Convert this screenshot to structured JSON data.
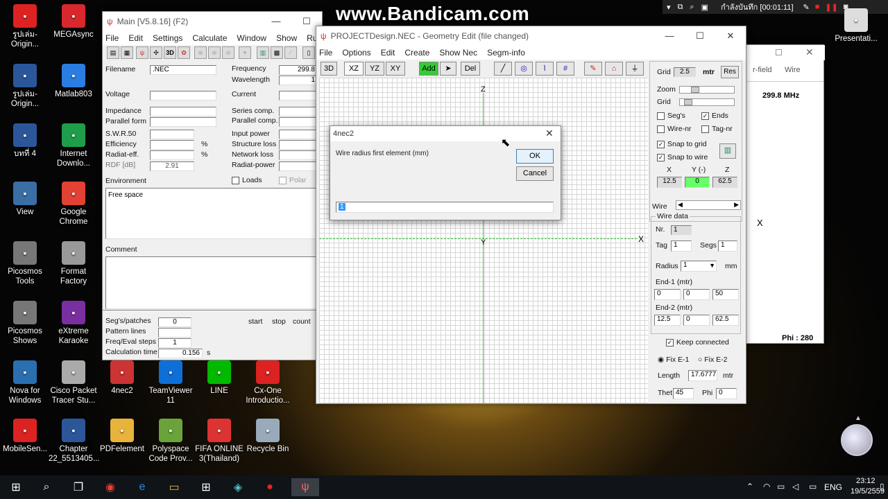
{
  "watermark": "www.Bandicam.com",
  "top_bar": {
    "rec_time": "กำลังบันทึก [00:01:11]"
  },
  "desktop_icons": [
    {
      "label": "รูปเล่ม-Origin...",
      "icon": "pdf-icon",
      "color": "#d22"
    },
    {
      "label": "MEGAsync",
      "icon": "mega-icon",
      "color": "#d9272e"
    },
    {
      "label": "รูปเล่ม-Origin...",
      "icon": "word-icon",
      "color": "#2b579a"
    },
    {
      "label": "Matlab803",
      "icon": "lightning-icon",
      "color": "#2a7de1"
    },
    {
      "label": "บทที่ 4",
      "icon": "word-icon",
      "color": "#2b579a"
    },
    {
      "label": "Internet Downlo...",
      "icon": "globe-icon",
      "color": "#1e9e4a"
    },
    {
      "label": "View",
      "icon": "view-icon",
      "color": "#3a6ea5"
    },
    {
      "label": "Google Chrome",
      "icon": "chrome-icon",
      "color": "#e34133"
    },
    {
      "label": "Picosmos Tools",
      "icon": "picosmos-icon",
      "color": "#777"
    },
    {
      "label": "Format Factory",
      "icon": "format-factory-icon",
      "color": "#999"
    },
    {
      "label": "Picosmos Shows",
      "icon": "picosmos-icon",
      "color": "#777"
    },
    {
      "label": "eXtreme Karaoke",
      "icon": "karaoke-icon",
      "color": "#7a2fa0"
    },
    {
      "label": "Nova for Windows",
      "icon": "nova-icon",
      "color": "#2a6fb0"
    },
    {
      "label": "Cisco Packet Tracer Stu...",
      "icon": "cisco-icon",
      "color": "#aaa"
    },
    {
      "label": "4nec2",
      "icon": "antenna-icon",
      "color": "#c33"
    },
    {
      "label": "TeamViewer 11",
      "icon": "teamviewer-icon",
      "color": "#0e6fd6"
    },
    {
      "label": "LINE",
      "icon": "line-icon",
      "color": "#00b900"
    },
    {
      "label": "Cx-One Introductio...",
      "icon": "pdf-icon",
      "color": "#d22"
    },
    {
      "label": "MobileSen...",
      "icon": "pdf-icon",
      "color": "#d22"
    },
    {
      "label": "Chapter 22_5513405...",
      "icon": "word-icon",
      "color": "#2b579a"
    },
    {
      "label": "PDFelement",
      "icon": "folder-icon",
      "color": "#e8b33a"
    },
    {
      "label": "Polyspace Code Prov...",
      "icon": "polyspace-icon",
      "color": "#6aa33a"
    },
    {
      "label": "FIFA ONLINE 3(Thailand)",
      "icon": "fifa-icon",
      "color": "#d33"
    },
    {
      "label": "Recycle Bin",
      "icon": "recycle-bin-icon",
      "color": "#9ab"
    },
    {
      "label": "Presentati...",
      "icon": "presentation-icon",
      "color": "#ddd"
    }
  ],
  "main_window": {
    "title": "Main [V5.8.16]  (F2)",
    "menu": [
      "File",
      "Edit",
      "Settings",
      "Calculate",
      "Window",
      "Show",
      "Run"
    ],
    "labels": {
      "filename": "Filename",
      "frequency": "Frequency",
      "wavelength": "Wavelength",
      "voltage": "Voltage",
      "current": "Current",
      "impedance": "Impedance",
      "series": "Series comp.",
      "parallel_form": "Parallel form",
      "parallel_comp": "Parallel comp.",
      "swr": "S.W.R.50",
      "input_power": "Input power",
      "efficiency": "Efficiency",
      "structure_loss": "Structure loss",
      "radiat_eff": "Radiat-eff.",
      "network_loss": "Network loss",
      "rdf": "RDF [dB]",
      "radiat_power": "Radiat-power",
      "environment": "Environment",
      "loads": "Loads",
      "polar": "Polar",
      "comment": "Comment",
      "segs": "Seg's/patches",
      "pattern": "Pattern lines",
      "freq_steps": "Freq/Eval steps",
      "calc_time": "Calculation time",
      "start": "start",
      "stop": "stop",
      "count": "count",
      "pct": "%",
      "s": "s"
    },
    "values": {
      "filename": ".NEC",
      "frequency": "299.8",
      "wavelength": "1",
      "rdf": "2.91",
      "environment": "Free space",
      "segs": "0",
      "freq_steps": "1",
      "calc_time": "0.156"
    }
  },
  "geometry_window": {
    "title": "PROJECTDesign.NEC - Geometry Edit (file changed)",
    "menu": [
      "File",
      "Options",
      "Edit",
      "Create",
      "Show Nec",
      "Segm-info"
    ],
    "toolbar": {
      "b3d": "3D",
      "xz": "XZ",
      "yz": "YZ",
      "xy": "XY",
      "add": "Add",
      "del": "Del"
    },
    "axis": {
      "z": "Z",
      "y": "Y",
      "x": "X"
    },
    "panel": {
      "grid_label": "Grid",
      "grid_value": "2.5",
      "unit": "mtr",
      "res": "Res",
      "zoom": "Zoom",
      "grid2": "Grid",
      "segs": "Seg's",
      "ends": "Ends",
      "wire_nr": "Wire-nr",
      "tag_nr": "Tag-nr",
      "snap_grid": "Snap to grid",
      "snap_wire": "Snap to wire",
      "x": "X",
      "y": "Y (-)",
      "z": "Z",
      "xv": "12.5",
      "yv": "0",
      "zv": "62.5",
      "wire": "Wire",
      "wire_data": "Wire data",
      "nr": "Nr.",
      "nr_v": "1",
      "tag": "Tag",
      "tag_v": "1",
      "segs2": "Segs",
      "segs_v": "1",
      "radius": "Radius",
      "radius_v": "1",
      "mm": "mm",
      "end1": "End-1 (mtr)",
      "e1x": "0",
      "e1y": "0",
      "e1z": "50",
      "end2": "End-2 (mtr)",
      "e2x": "12.5",
      "e2y": "0",
      "e2z": "62.5",
      "keep": "Keep connected",
      "fix1": "Fix E-1",
      "fix2": "Fix E-2",
      "length": "Length",
      "length_v": "17.6777",
      "mtr": "mtr",
      "thet": "Thet",
      "thet_v": "45",
      "phi": "Phi",
      "phi_v": "0"
    }
  },
  "back_window": {
    "far_field": "r-field",
    "wire": "Wire",
    "freq": "299.8 MHz",
    "phi": "Phi : 280",
    "x": "X"
  },
  "dialog": {
    "title": "4nec2",
    "prompt": "Wire radius first element (mm)",
    "ok": "OK",
    "cancel": "Cancel",
    "input_value": "1"
  },
  "tray": {
    "lang": "ENG",
    "time": "23:12",
    "date": "19/5/2559"
  },
  "colors": {
    "add_button": "#33cc33",
    "snap_y": "#66ff66",
    "axis_green": "#22aa22"
  }
}
